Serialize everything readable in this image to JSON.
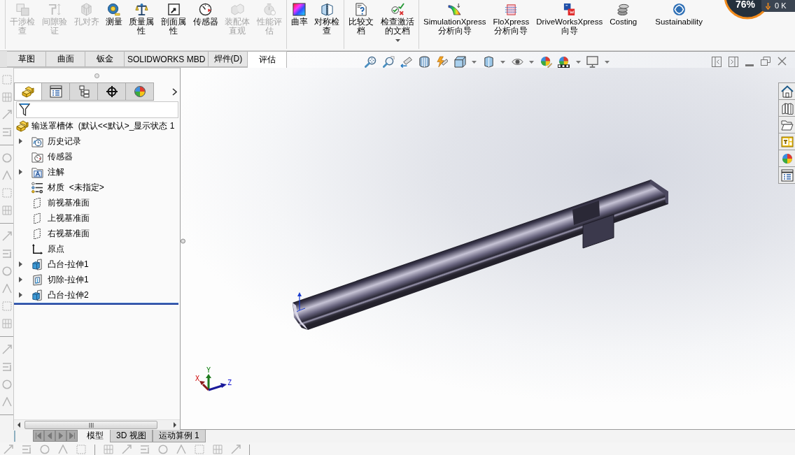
{
  "ribbon": {
    "groups": [
      {
        "buttons": [
          {
            "label": "干涉检查",
            "disabled": true,
            "dropdown": false
          },
          {
            "label": "间隙验证",
            "disabled": true,
            "dropdown": false
          },
          {
            "label": "孔对齐",
            "disabled": true,
            "dropdown": false
          },
          {
            "label": "测量",
            "disabled": false,
            "dropdown": false
          },
          {
            "label": "质量属性",
            "disabled": false,
            "dropdown": false
          },
          {
            "label": "剖面属性",
            "disabled": false,
            "dropdown": false
          },
          {
            "label": "传感器",
            "disabled": false,
            "dropdown": false
          },
          {
            "label": "装配体直观",
            "disabled": true,
            "dropdown": false
          },
          {
            "label": "性能评估",
            "disabled": true,
            "dropdown": false
          }
        ]
      },
      {
        "buttons": [
          {
            "label": "曲率",
            "disabled": false,
            "dropdown": false
          },
          {
            "label": "对称检查",
            "disabled": false,
            "dropdown": false
          }
        ]
      },
      {
        "buttons": [
          {
            "label": "比较文档",
            "disabled": false,
            "dropdown": false
          },
          {
            "label": "检查激活的文档",
            "disabled": false,
            "dropdown": true
          }
        ]
      },
      {
        "buttons": [
          {
            "label": "SimulationXpress 分析向导",
            "disabled": false,
            "dropdown": false
          },
          {
            "label": "FloXpress 分析向导",
            "disabled": false,
            "dropdown": false
          },
          {
            "label": "DriveWorksXpress 向导",
            "disabled": false,
            "dropdown": false
          },
          {
            "label": "Costing",
            "disabled": false,
            "dropdown": false
          },
          {
            "label": "Sustainability",
            "disabled": false,
            "dropdown": false
          }
        ]
      }
    ]
  },
  "speed_widget": {
    "percent": "76%",
    "download": "0 K"
  },
  "command_tabs": [
    {
      "label": "草图",
      "selected": false
    },
    {
      "label": "曲面",
      "selected": false
    },
    {
      "label": "钣金",
      "selected": false
    },
    {
      "label": "SOLIDWORKS MBD",
      "selected": false
    },
    {
      "label": "焊件(D)",
      "selected": false
    },
    {
      "label": "评估",
      "selected": true
    }
  ],
  "feature_manager": {
    "panel_tabs": [
      {
        "selected": true
      },
      {
        "selected": false
      },
      {
        "selected": false
      },
      {
        "selected": false
      },
      {
        "selected": false
      }
    ],
    "tree": {
      "label": "输送罩槽体  (默认<<默认>_显示状态 1",
      "children": [
        {
          "label": "历史记录",
          "kind": "history",
          "expandable": true
        },
        {
          "label": "传感器",
          "kind": "sensors",
          "expandable": false
        },
        {
          "label": "注解",
          "kind": "annotations",
          "expandable": true
        },
        {
          "label": "材质  <未指定>",
          "kind": "material",
          "expandable": false
        },
        {
          "label": "前视基准面",
          "kind": "plane",
          "expandable": false
        },
        {
          "label": "上视基准面",
          "kind": "plane",
          "expandable": false
        },
        {
          "label": "右视基准面",
          "kind": "plane",
          "expandable": false
        },
        {
          "label": "原点",
          "kind": "origin",
          "expandable": false
        },
        {
          "label": "凸台-拉伸1",
          "kind": "boss",
          "expandable": true
        },
        {
          "label": "切除-拉伸1",
          "kind": "cut",
          "expandable": true
        },
        {
          "label": "凸台-拉伸2",
          "kind": "boss",
          "expandable": true
        }
      ]
    }
  },
  "triad": {
    "axes": [
      {
        "label": "X"
      },
      {
        "label": "Y"
      },
      {
        "label": "Z"
      }
    ]
  },
  "model_tabs": [
    {
      "label": "模型",
      "selected": true
    },
    {
      "label": "3D 视图",
      "selected": false
    },
    {
      "label": "运动算例 1",
      "selected": false
    }
  ]
}
